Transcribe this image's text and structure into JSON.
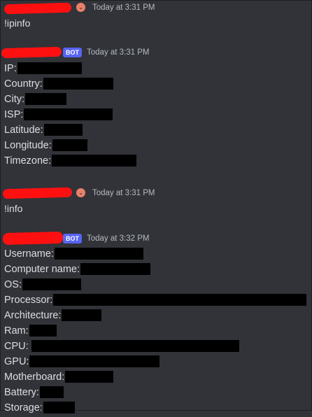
{
  "messages": [
    {
      "timestamp": "Today at 3:31 PM",
      "content": "!ipinfo"
    },
    {
      "bot_badge": "BOT",
      "timestamp": "Today at 3:31 PM",
      "fields": [
        "IP:",
        "Country:",
        "City:",
        "ISP:",
        "Latitude:",
        "Longitude:",
        "Timezone:"
      ]
    },
    {
      "timestamp": "Today at 3:31 PM",
      "content": "!info"
    },
    {
      "bot_badge": "BOT",
      "timestamp": "Today at 3:32 PM",
      "fields": [
        "Username:",
        "Computer name:",
        "OS:",
        "Processor:",
        "Architecture:",
        "Ram:",
        "CPU:",
        "GPU:",
        "Motherboard:",
        "Battery:",
        "Storage:"
      ]
    }
  ],
  "colors": {
    "background": "#313338",
    "text": "#dbdee1",
    "bot_badge": "#5865f2",
    "redaction_name": "#ff1010",
    "redaction_value": "#000000"
  }
}
